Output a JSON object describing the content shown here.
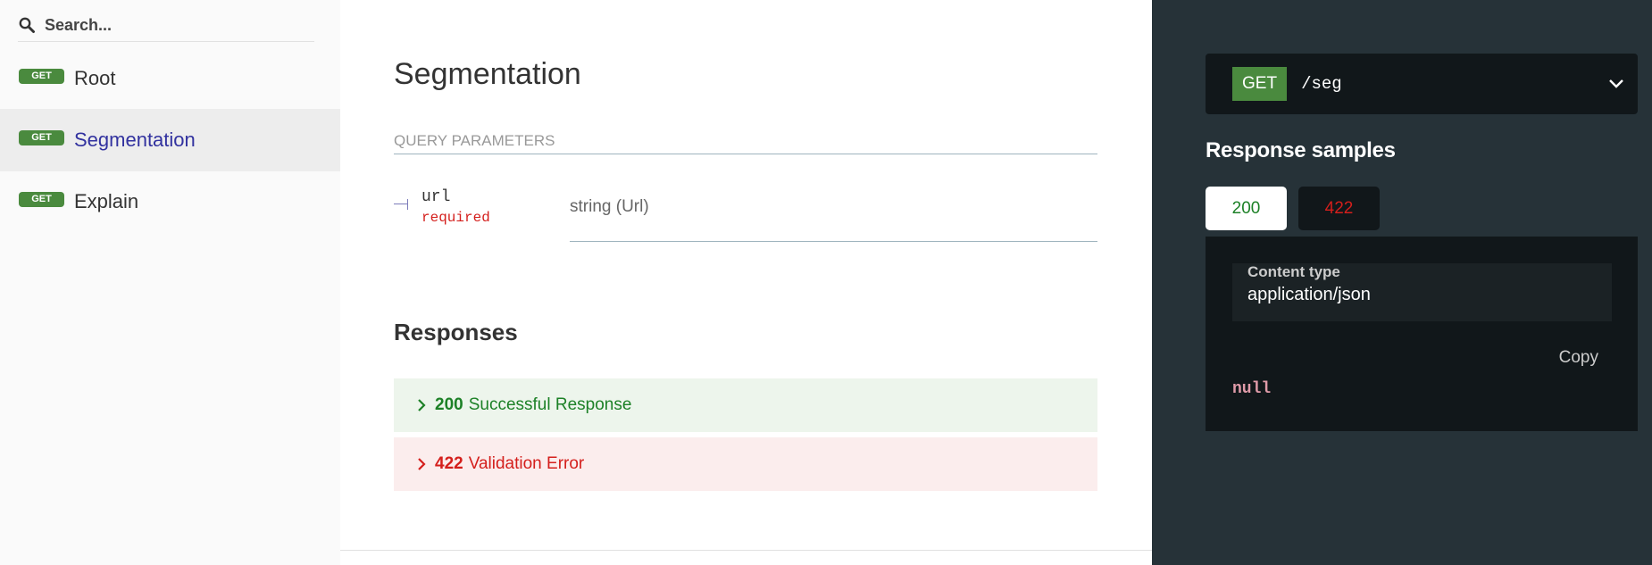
{
  "sidebar": {
    "search": {
      "placeholder": "Search...",
      "value": ""
    },
    "items": [
      {
        "method": "GET",
        "label": "Root",
        "active": false
      },
      {
        "method": "GET",
        "label": "Segmentation",
        "active": true
      },
      {
        "method": "GET",
        "label": "Explain",
        "active": false
      }
    ]
  },
  "operation": {
    "title": "Segmentation",
    "query_params_header": "QUERY PARAMETERS",
    "params": [
      {
        "name": "url",
        "required_label": "required",
        "type": "string (Url)"
      }
    ],
    "responses_title": "Responses",
    "responses": [
      {
        "code": "200",
        "description": "Successful Response"
      },
      {
        "code": "422",
        "description": "Validation Error"
      }
    ]
  },
  "right_panel": {
    "endpoint": {
      "method": "GET",
      "path": "/seg"
    },
    "samples_title": "Response samples",
    "tabs": [
      {
        "label": "200",
        "selected": true
      },
      {
        "label": "422",
        "selected": false
      }
    ],
    "content_type_label": "Content type",
    "content_type_value": "application/json",
    "copy_label": "Copy",
    "sample_body": "null"
  },
  "colors": {
    "get_badge": "#4a8a3e",
    "active_link": "#32329f",
    "success": "#1d8127",
    "error": "#d41f1c",
    "dark_panel": "#263238",
    "code_bg": "#11171a"
  }
}
